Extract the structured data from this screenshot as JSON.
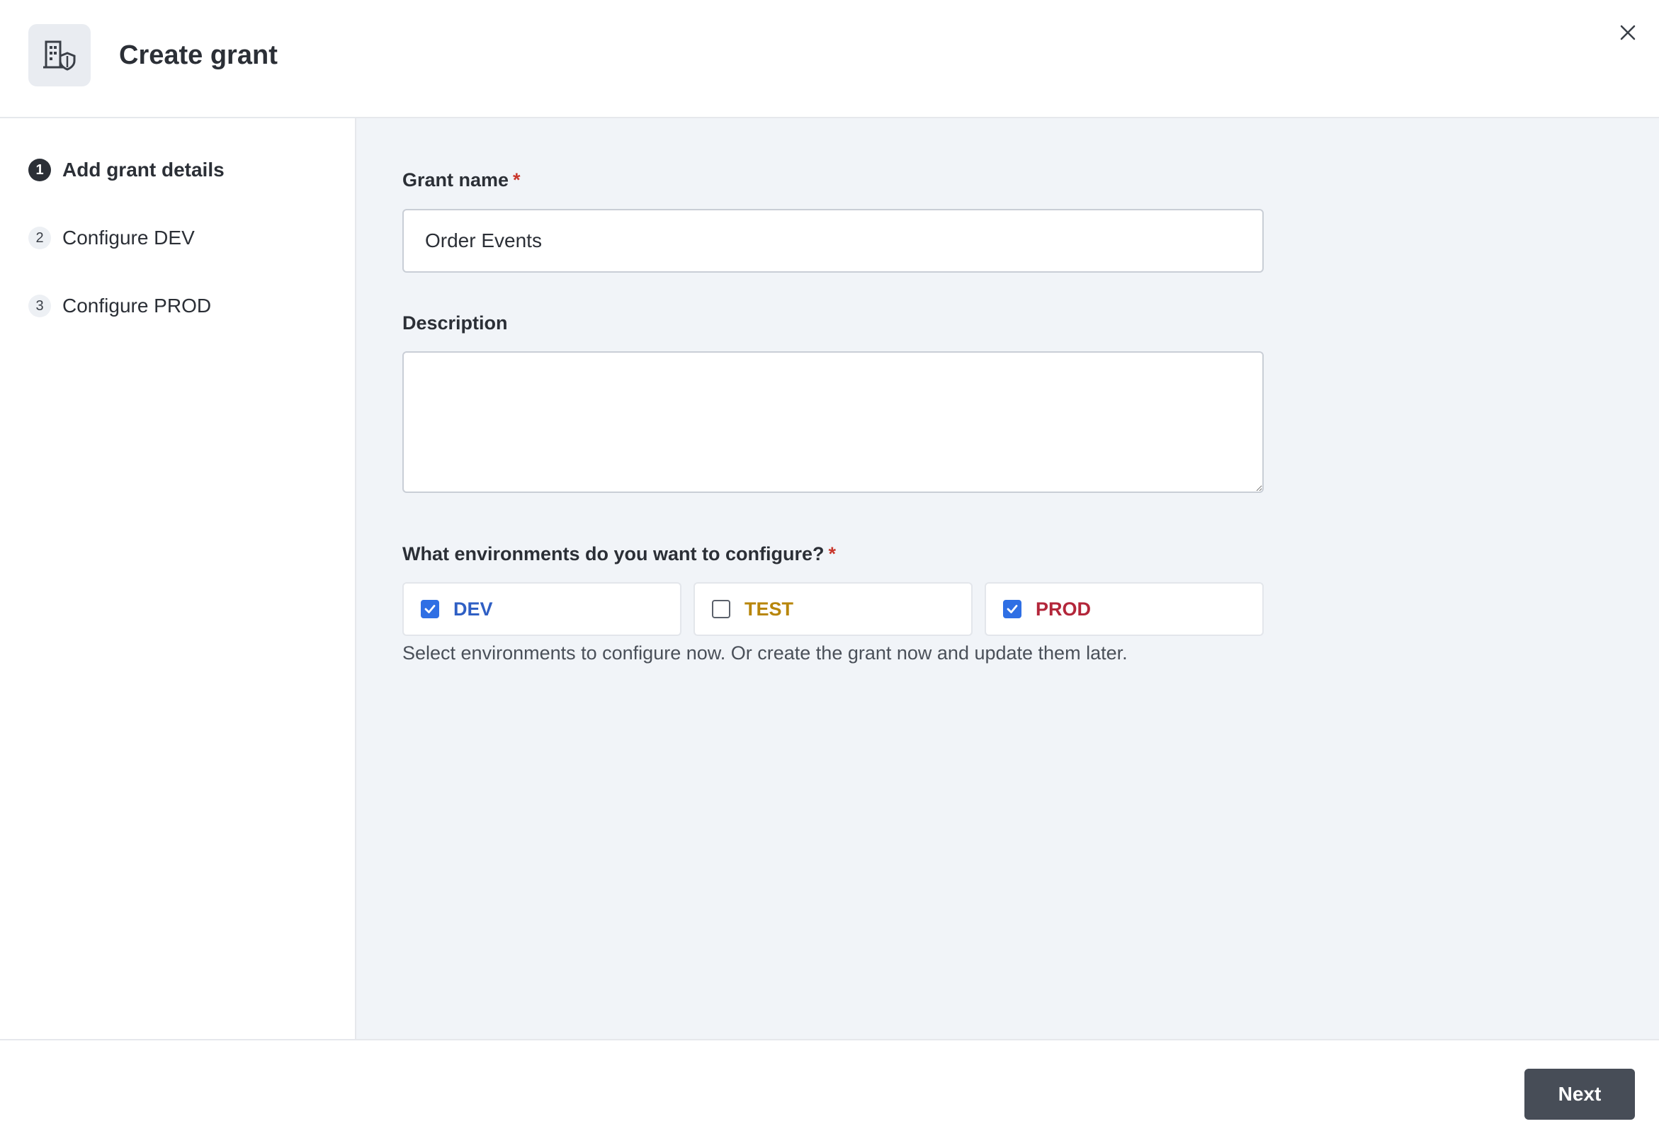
{
  "header": {
    "title": "Create grant",
    "icon": "building-shield-icon"
  },
  "sidebar": {
    "steps": [
      {
        "number": "1",
        "label": "Add grant details",
        "active": true
      },
      {
        "number": "2",
        "label": "Configure DEV",
        "active": false
      },
      {
        "number": "3",
        "label": "Configure PROD",
        "active": false
      }
    ]
  },
  "form": {
    "grant_name": {
      "label": "Grant name",
      "required_mark": "*",
      "value": "Order Events"
    },
    "description": {
      "label": "Description",
      "value": ""
    },
    "environments": {
      "label": "What environments do you want to configure?",
      "required_mark": "*",
      "options": [
        {
          "label": "DEV",
          "checked": true,
          "color": "#2f5fc4"
        },
        {
          "label": "TEST",
          "checked": false,
          "color": "#b8860b"
        },
        {
          "label": "PROD",
          "checked": true,
          "color": "#b3263a"
        }
      ],
      "help_text": "Select environments to configure now. Or create the grant now and update them later."
    }
  },
  "footer": {
    "next_label": "Next"
  },
  "colors": {
    "accent_checkbox": "#2f6fe4",
    "primary_button": "#474d57",
    "main_background": "#f1f4f8",
    "required": "#c9372c"
  }
}
